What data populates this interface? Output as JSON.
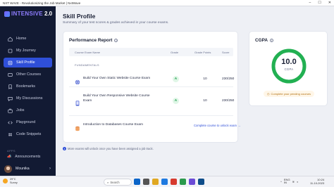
{
  "window": {
    "title": "NXT WAVE - Revolutionizing the Job Market | NxtWave",
    "controls": [
      "–",
      "☐",
      "✕"
    ]
  },
  "sidebar": {
    "logo_text": "INTENSIVE",
    "logo_version": "2.0",
    "items": [
      {
        "label": "Home",
        "icon": "home-icon"
      },
      {
        "label": "My Journey",
        "icon": "journey-icon"
      },
      {
        "label": "Skill Profile",
        "icon": "profile-icon",
        "active": true
      },
      {
        "label": "Other Courses",
        "icon": "courses-icon"
      },
      {
        "label": "Bookmarks",
        "icon": "bookmark-icon"
      },
      {
        "label": "My Discussions",
        "icon": "chat-icon"
      },
      {
        "label": "Jobs",
        "icon": "briefcase-icon"
      },
      {
        "label": "Playground",
        "icon": "code-icon"
      },
      {
        "label": "Code Snippets",
        "icon": "snippet-icon"
      }
    ],
    "apps_label": "APPS",
    "announcements": "Announcements",
    "user_name": "Mounika"
  },
  "main": {
    "title": "Skill Profile",
    "subtitle": "Summary of your test scores & grades achieved in your course exams.",
    "performance": {
      "title": "Performance Report",
      "columns": {
        "name": "Course Exam Name",
        "grade": "Grade",
        "points": "Grade Points",
        "score": "Score"
      },
      "section": "FUNDAMENTALS",
      "rows": [
        {
          "name": "Build Your Own Static Website Course Exam",
          "grade": "A",
          "points": "10",
          "score": "230/250"
        },
        {
          "name": "Build Your Own Responsive Website Course Exam",
          "grade": "A",
          "points": "10",
          "score": "230/250"
        },
        {
          "name": "Introduction to Databases Course Exam",
          "unlock": "Complete course to unlock exam →"
        }
      ]
    },
    "footnote": "More exams will unlock once you have been assigned a job track.",
    "cgpa": {
      "title": "CGPA",
      "value": "10.0",
      "label": "CGPA",
      "fraction": 1.0,
      "pending": "Complete your pending courses"
    }
  },
  "taskbar": {
    "weather_temp": "29°C",
    "weather_desc": "Sunny",
    "search_placeholder": "Search",
    "lang": "ENG\nIN",
    "time": "10:24",
    "date": "11-10-2023"
  },
  "colors": {
    "accent": "#2f4fd8",
    "sidebar_bg": "#121a33",
    "success": "#1a9d4b",
    "ring": "#22b052"
  }
}
